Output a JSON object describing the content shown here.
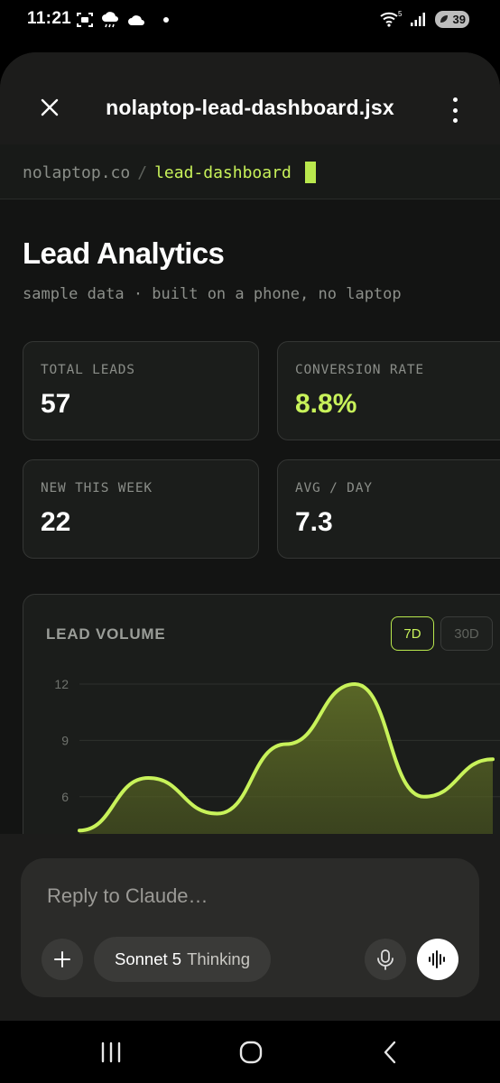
{
  "status_bar": {
    "time": "11:21",
    "wifi_label": "5",
    "battery": "39",
    "icons": [
      "screenshot-icon",
      "cloud-rain-icon",
      "cloud-icon",
      "notification-dot",
      "wifi-icon",
      "signal-icon",
      "battery-icon"
    ]
  },
  "header": {
    "file_name": "nolaptop-lead-dashboard.jsx",
    "close_icon": "close-icon",
    "menu_icon": "more-vert-icon"
  },
  "preview": {
    "breadcrumb": {
      "site": "nolaptop.co",
      "separator": "/",
      "page": "lead-dashboard"
    },
    "title": "Lead Analytics",
    "subtitle": "sample data · built on a phone, no laptop",
    "stats": [
      {
        "label": "TOTAL LEADS",
        "value": "57"
      },
      {
        "label": "CONVERSION RATE",
        "value": "8.8%"
      },
      {
        "label": "NEW THIS WEEK",
        "value": "22"
      },
      {
        "label": "AVG / DAY",
        "value": "7.3"
      }
    ],
    "chart": {
      "title": "LEAD VOLUME",
      "range_options": [
        "7D",
        "30D"
      ],
      "selected_range": "7D"
    }
  },
  "chart_data": {
    "type": "area",
    "title": "LEAD VOLUME",
    "xlabel": "",
    "ylabel": "",
    "y_ticks": [
      "12",
      "9",
      "6"
    ],
    "ylim": [
      4,
      12.5
    ],
    "values": [
      4.2,
      7,
      5.1,
      8.8,
      12,
      6,
      8
    ],
    "grid": true,
    "line_color": "#c8f25a",
    "fill_color": "#4a5a1c"
  },
  "composer": {
    "placeholder": "Reply to Claude…",
    "model_name": "Sonnet 5",
    "model_mode": "Thinking",
    "icons": [
      "plus-icon",
      "mic-icon",
      "voice-waveform-icon"
    ]
  },
  "nav": {
    "icons": [
      "recent-apps-icon",
      "home-icon",
      "back-icon"
    ]
  },
  "colors": {
    "accent": "#c8f25a",
    "background": "#131413",
    "card": "#1b1d1b"
  }
}
